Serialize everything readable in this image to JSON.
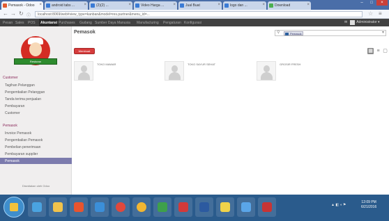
{
  "browser": {
    "tabs": [
      {
        "label": "Pemasok - Odoo",
        "active": true
      },
      {
        "label": "android tabs ..."
      },
      {
        "label": "(2)(2) ..."
      },
      {
        "label": "Video Harga ..."
      },
      {
        "label": "Jual Buat"
      },
      {
        "label": "logo dan ..."
      },
      {
        "label": "Download"
      }
    ],
    "url": "localhost:8069/web#view_type=kanban&model=res.partner&menu_id=..."
  },
  "app_menu": {
    "items": [
      "Pesan",
      "Sales",
      "POS",
      "Akuntansi",
      "Purchases",
      "Gudang",
      "Sumber Daya Manusia",
      "Manufacturing",
      "Pengaturan",
      "Konfigurasi"
    ],
    "active": "Akuntansi",
    "user": "Administrator"
  },
  "sidebar": {
    "logo_text": "Restoran",
    "sections": [
      {
        "title": "Customer",
        "items": [
          "Tagihan Pelanggan",
          "Pengembalian Pelanggan",
          "Tanda terima penjualan",
          "Pembayaran",
          "Customer"
        ]
      },
      {
        "title": "Pemasok",
        "items": [
          "Invoice Pemasok",
          "Pengembalian Pemasok",
          "Pembelian penerimaan",
          "Pembayaran supplier",
          "Pemasok"
        ]
      }
    ],
    "active_item": "Pemasok",
    "footer": "Disediakan oleh Odoo"
  },
  "main": {
    "title": "Pemasok",
    "create_label": "Membuat",
    "search_facet": "Pemasok",
    "cards": [
      {
        "name": "TOKO MAWAR"
      },
      {
        "name": "TOKO SAYUR SEHAT"
      },
      {
        "name": "GROSIR FRESH"
      }
    ]
  },
  "taskbar": {
    "clock_time": "12:09 PM",
    "clock_date": "6/21/2016"
  },
  "colors": {
    "browser_frame": "#4a6ea8",
    "app_menu_bg": "#414141",
    "sidebar_bg": "#f0eeee",
    "sidebar_active": "#7c7bad",
    "section_title": "#8a2a5b",
    "create_button": "#d63c3c",
    "taskbar_bg": "#2a5b8c"
  }
}
